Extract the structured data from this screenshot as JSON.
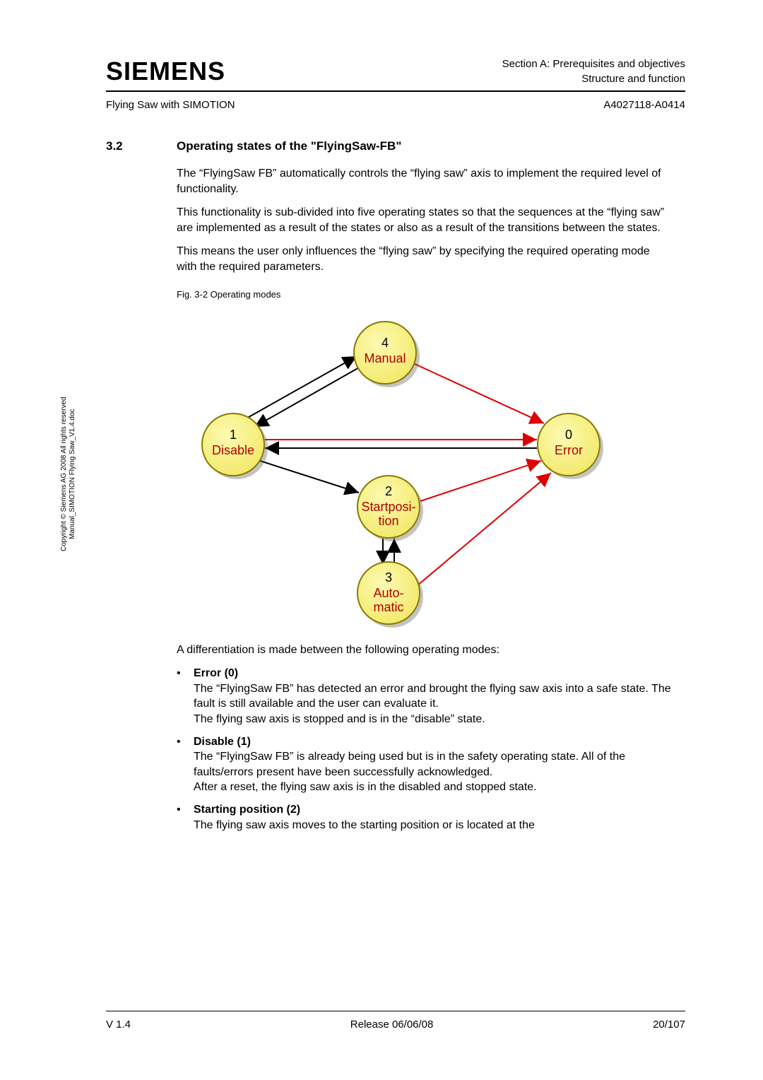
{
  "header": {
    "logo": "SIEMENS",
    "section_line1": "Section A: Prerequisites and objectives",
    "section_line2": "Structure and function",
    "doc_title": "Flying Saw with SIMOTION",
    "doc_num": "A4027118-A0414"
  },
  "section": {
    "num": "3.2",
    "title": "Operating states of the \"FlyingSaw-FB\""
  },
  "paragraphs": {
    "p1": "The “FlyingSaw FB” automatically controls the “flying saw” axis to implement the required level of functionality.",
    "p2": "This functionality is sub-divided into five operating states so that the sequences at the “flying saw” are implemented as a result of the states or also as a result of the transitions between the states.",
    "p3": "This means the user only influences the “flying saw” by specifying the required operating mode with the required parameters.",
    "fig_caption": "Fig. 3-2 Operating modes",
    "p4": "A differentiation is made between the following operating modes:"
  },
  "diagram": {
    "nodes": {
      "manual": {
        "num": "4",
        "label": "Manual"
      },
      "disable": {
        "num": "1",
        "label": "Disable"
      },
      "error": {
        "num": "0",
        "label": "Error"
      },
      "startpos": {
        "num": "2",
        "label1": "Startposi-",
        "label2": "tion"
      },
      "automatic": {
        "num": "3",
        "label1": "Auto-",
        "label2": "matic"
      }
    }
  },
  "bullets": [
    {
      "title": "Error (0)",
      "text": "The “FlyingSaw FB” has detected an error and brought the flying saw axis into a safe state. The fault is still available and the user can evaluate it.\nThe flying saw axis is stopped and is in the “disable” state."
    },
    {
      "title": "Disable (1)",
      "text": "The “FlyingSaw FB” is already being used but is in the safety operating state. All of the faults/errors present have been successfully acknowledged.\nAfter a reset, the flying saw axis is in the disabled and stopped state."
    },
    {
      "title": "Starting position (2)",
      "text": "The flying saw axis moves to the starting position or is located at the"
    }
  ],
  "side_text": {
    "line1": "Copyright © Siemens AG 2008 All rights reserved",
    "line2": "Manual_SIMOTION Flying Saw_V1.4.doc"
  },
  "footer": {
    "left": "V 1.4",
    "center": "Release 06/06/08",
    "right": "20/107"
  }
}
